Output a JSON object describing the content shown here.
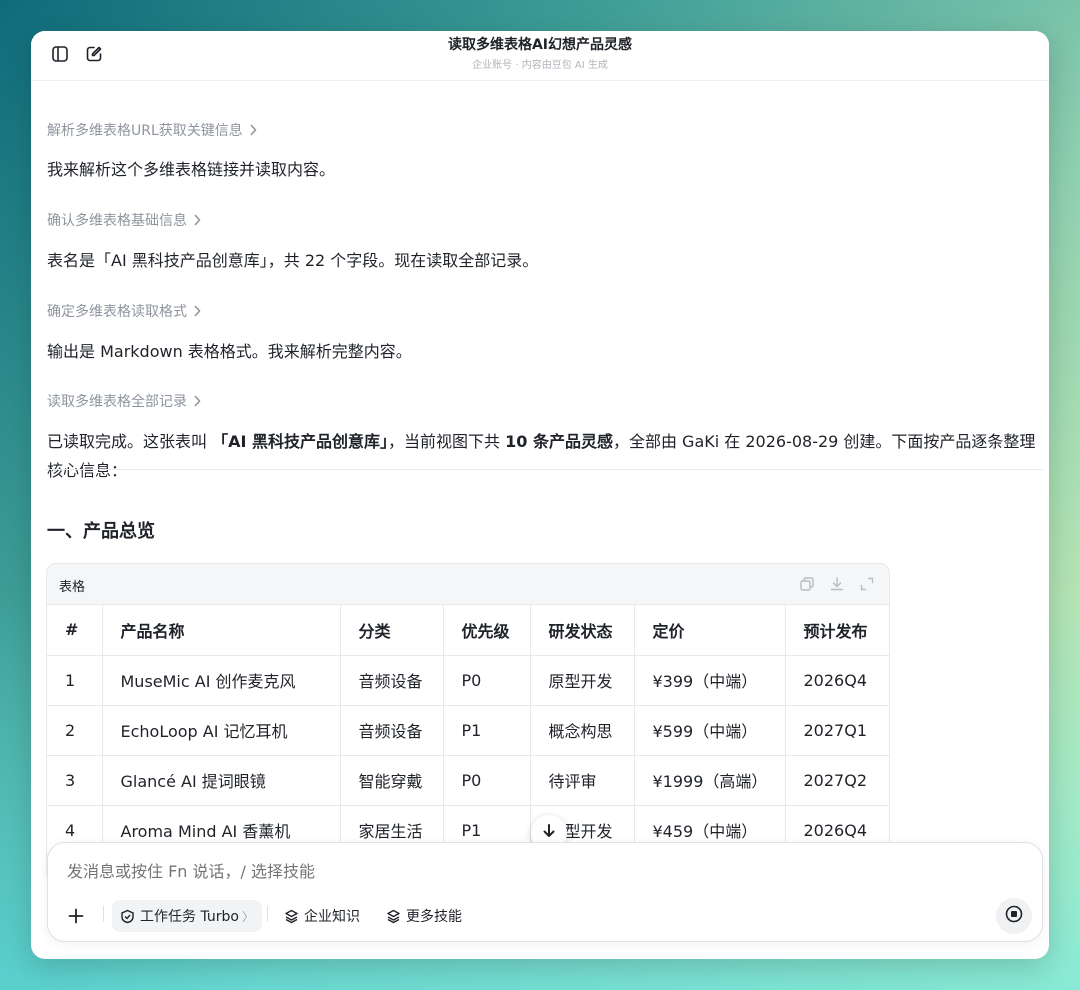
{
  "window": {
    "title": "读取多维表格AI幻想产品灵感",
    "subtitle": "企业账号 · 内容由豆包 AI 生成"
  },
  "steps": [
    {
      "label": "解析多维表格URL获取关键信息",
      "text": "我来解析这个多维表格链接并读取内容。"
    },
    {
      "label": "确认多维表格基础信息",
      "text": "表名是「AI 黑科技产品创意库」，共 22 个字段。现在读取全部记录。"
    },
    {
      "label": "确定多维表格读取格式",
      "text": "输出是 Markdown 表格格式。我来解析完整内容。"
    },
    {
      "label": "读取多维表格全部记录"
    }
  ],
  "summary": {
    "p1": "已读取完成。这张表叫 ",
    "b1": "「AI 黑科技产品创意库」",
    "p2": "，当前视图下共 ",
    "b2": "10 条产品灵感",
    "p3": "，全部由 GaKi 在 2026-08-29 创建。下面按产品逐条整理核心信息："
  },
  "section_title": "一、产品总览",
  "table": {
    "label": "表格",
    "columns": [
      "#",
      "产品名称",
      "分类",
      "优先级",
      "研发状态",
      "定价",
      "预计发布"
    ],
    "rows": [
      [
        "1",
        "MuseMic AI 创作麦克风",
        "音频设备",
        "P0",
        "原型开发",
        "¥399（中端）",
        "2026Q4"
      ],
      [
        "2",
        "EchoLoop AI 记忆耳机",
        "音频设备",
        "P1",
        "概念构思",
        "¥599（中端）",
        "2027Q1"
      ],
      [
        "3",
        "Glancé AI 提词眼镜",
        "智能穿戴",
        "P0",
        "待评审",
        "¥1999（高端）",
        "2027Q2"
      ],
      [
        "4",
        "Aroma Mind AI 香薰机",
        "家居生活",
        "P1",
        "原型开发",
        "¥459（中端）",
        "2026Q4"
      ]
    ]
  },
  "composer": {
    "placeholder": "发消息或按住 Fn 说话，/ 选择技能",
    "chip_task": "工作任务 Turbo",
    "chip_task_tail": "〉",
    "chip_knowledge": "企业知识",
    "chip_skills": "更多技能"
  }
}
